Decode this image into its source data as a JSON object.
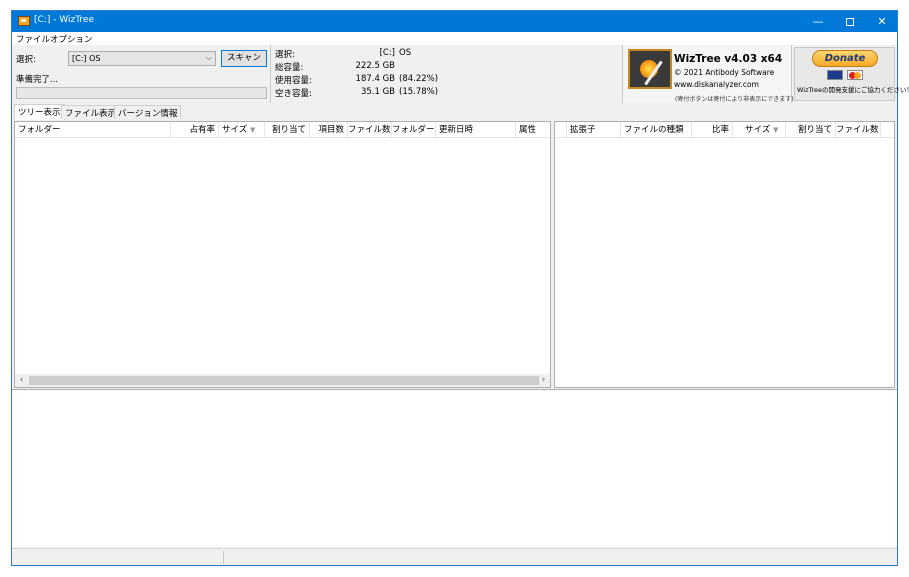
{
  "window": {
    "title": "[C:]  - WizTree"
  },
  "menu": [
    "ファイル",
    "オプション"
  ],
  "select": {
    "label": "選択:",
    "drive_value": "[C:] OS",
    "scan_label": "スキャン",
    "status": "準備完了..."
  },
  "info": {
    "rows": [
      {
        "key": "選択:",
        "value": "[C:]",
        "extra": "OS"
      },
      {
        "key": "総容量:",
        "value": "222.5 GB",
        "extra": ""
      },
      {
        "key": "使用容量:",
        "value": "187.4 GB",
        "extra": "(84.22%)"
      },
      {
        "key": "空き容量:",
        "value": "35.1 GB",
        "extra": "(15.78%)"
      }
    ]
  },
  "brand": {
    "title": "WizTree v4.03 x64",
    "copyright": "© 2021 Antibody Software",
    "url": "www.diskanalyzer.com",
    "note": "(寄付ボタンは寄付により非表示にできます)"
  },
  "donate": {
    "button": "Donate",
    "note": "WizTreeの開発支援にご協力ください！"
  },
  "tabs": [
    "ツリー表示",
    "ファイル表示",
    "バージョン情報"
  ],
  "tree_columns": [
    "フォルダー",
    "占有率",
    "サイズ",
    "割り当て",
    "項目数",
    "ファイル数",
    "フォルダー",
    "更新日時",
    "属性"
  ],
  "ext_columns": [
    "拡張子",
    "ファイルの種類",
    "比率",
    "サイズ",
    "割り当て",
    "ファイル数"
  ],
  "icons": {
    "app": "wiztree-app-icon",
    "minimize": "minimize-icon",
    "maximize": "maximize-icon",
    "close": "close-icon"
  }
}
